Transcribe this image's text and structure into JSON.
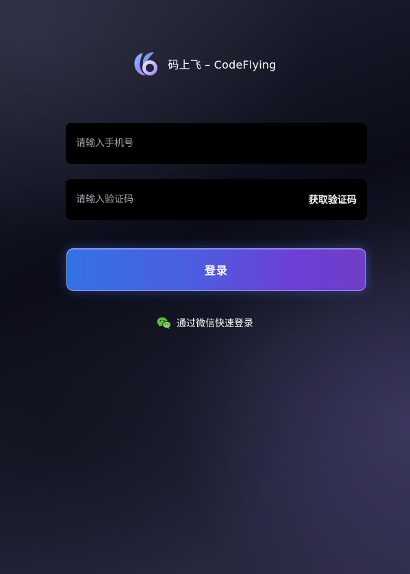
{
  "header": {
    "logo_icon": "codeflying-logo-icon",
    "title": "码上飞 – CodeFlying"
  },
  "form": {
    "phone_placeholder": "请输入手机号",
    "phone_value": "",
    "code_placeholder": "请输入验证码",
    "code_value": "",
    "get_code_label": "获取验证码",
    "login_label": "登录"
  },
  "wechat": {
    "icon": "wechat-icon",
    "label": "通过微信快速登录"
  },
  "colors": {
    "input_background": "#000000",
    "button_gradient_start": "#3571e6",
    "button_gradient_end": "#6f3ec7",
    "wechat_green": "#5fbf3a",
    "placeholder_text": "#a4a4ae"
  }
}
